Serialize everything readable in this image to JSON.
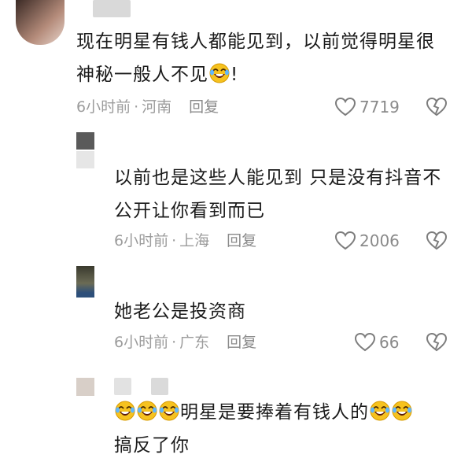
{
  "comments": [
    {
      "text_line1": "现在明星有钱人都能见到，以前觉得明星很",
      "text_line2_a": "神秘一般人不见",
      "text_line2_b": "!",
      "time": "6小时前",
      "dot": "·",
      "location": "河南",
      "reply": "回复",
      "likes": "7719"
    },
    {
      "text_line1": "以前也是这些人能见到  只是没有抖音不",
      "text_line2": "公开让你看到而已",
      "time": "6小时前",
      "dot": "·",
      "location": "上海",
      "reply": "回复",
      "likes": "2006"
    },
    {
      "text_line1": "她老公是投资商",
      "time": "6小时前",
      "dot": "·",
      "location": "广东",
      "reply": "回复",
      "likes": "66"
    },
    {
      "text_line1": "明星是要捧着有钱人的",
      "text_line2": "搞反了你"
    }
  ],
  "icons": {
    "like": "heart-outline-icon",
    "dislike": "broken-heart-icon",
    "emoji": "laughing-crying-emoji"
  }
}
